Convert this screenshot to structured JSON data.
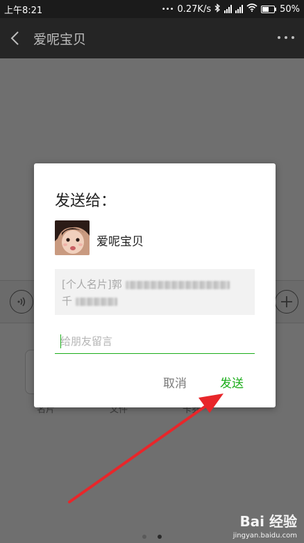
{
  "status_bar": {
    "time": "上午8:21",
    "dots": "•••",
    "speed": "0.27K/s",
    "battery_percent": "50%",
    "battery_level": 0.5
  },
  "header": {
    "title": "爱呢宝贝",
    "back_icon": "chevron-left-icon",
    "more_icon": "more-dots-icon"
  },
  "background_panel": {
    "labels": [
      "名片",
      "文件",
      "卡券"
    ]
  },
  "dialog": {
    "title": "发送给：",
    "contact_name": "爱呢宝贝",
    "card_prefix": "[个人名片]郭",
    "card_line2_prefix": "千",
    "message_placeholder": "给朋友留言",
    "cancel_label": "取消",
    "send_label": "发送"
  },
  "colors": {
    "accent_green": "#1aad19",
    "annotation_red": "#e8262a"
  },
  "watermark": {
    "logo_text": "Bai 经验",
    "url": "jingyan.baidu.com"
  }
}
